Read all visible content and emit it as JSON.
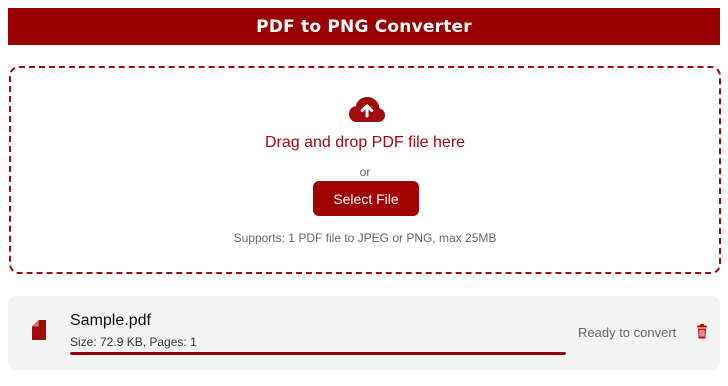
{
  "header": {
    "title": "PDF to PNG Converter"
  },
  "dropzone": {
    "icon": "cloud-upload-icon",
    "drop_text": "Drag and drop PDF file here",
    "or_text": "or",
    "select_label": "Select File",
    "supports_text": "Supports: 1 PDF file to JPEG or PNG, max 25MB"
  },
  "file": {
    "icon": "pdf-file-icon",
    "name": "Sample.pdf",
    "meta": "Size: 72.9 KB, Pages: 1",
    "progress": 1,
    "status": "Ready to convert",
    "delete_icon": "trash-icon"
  },
  "colors": {
    "accent": "#9b0000",
    "text_muted": "#666666",
    "card_bg": "#f4f4f4"
  }
}
